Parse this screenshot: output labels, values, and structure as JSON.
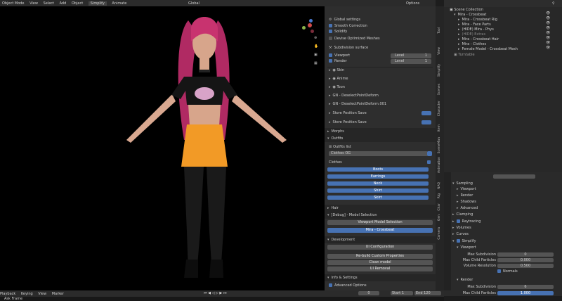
{
  "header": {
    "mode": "Object Mode",
    "menus": [
      "View",
      "Select",
      "Add",
      "Object"
    ],
    "addon": "Simplify",
    "addon2": "Animate",
    "transform": "Global",
    "options": "Options"
  },
  "npanel": {
    "global_settings": "Global settings",
    "smooth_correction": "Smooth Correction",
    "solidify": "Solidify",
    "devices_optimized": "Devise Optimized Meshes",
    "subdivision": "Subdivision surface",
    "viewport_label": "Viewport",
    "render_label": "Render",
    "level_label": "Level",
    "level_vp": "1",
    "level_r": "1",
    "items": [
      "Skin",
      "Anime",
      "Toon",
      "GN - DeselectPointDeform",
      "GN - DeselectPointDeform.001",
      "Store Position Save",
      "Store Position Save"
    ],
    "morphs": "Morphs",
    "outfits": "Outfits",
    "outfits_list": "Outfits list",
    "outfit_selected": "Clothes OG",
    "clothes": "Clothes",
    "clothes_items": [
      "Boots",
      "Earrings",
      "Neck",
      "Shirt",
      "Skirt"
    ],
    "hair": "Hair",
    "model_selection_header": "[Debug] - Model Selection",
    "viewport_model_selection": "Viewport Model Selection",
    "model_name": "Mira - Crossbeat",
    "development": "Development",
    "ui_configuration": "UI Configuration",
    "rebuild": "Re-build Custom Properties",
    "clean_model": "Clean model",
    "ui_removal": "UI Removal",
    "info_settings": "Info & Settings",
    "advanced_options": "Advanced Options",
    "tabs": [
      "Tool",
      "View",
      "Simplify",
      "Scenes",
      "Character",
      "Item",
      "SceneMan",
      "Animation",
      "NAQ",
      "Rig",
      "Char",
      "Gen",
      "Camera"
    ]
  },
  "outliner": {
    "scene_collection": "Scene Collection",
    "items": [
      "Mira - Crossbeat",
      "Mira - Crossbeat Rig",
      "Mira - Face Parts",
      "(HIDE) Mira - Phys",
      "(HIDE) Extras",
      "Mira - Crossbeat Hair",
      "Mira - Clothes",
      "Female Model - Crossbeat Mesh"
    ],
    "turntable": "Turntable"
  },
  "properties": {
    "sampling": "Sampling",
    "viewport": "Viewport",
    "render": "Render",
    "shadows": "Shadows",
    "advanced": "Advanced",
    "clamping": "Clamping",
    "raytracing": "Raytracing",
    "volumes": "Volumes",
    "curves": "Curves",
    "simplify": "Simplify",
    "viewport_sub": "Viewport",
    "max_subdivision": "Max Subdivision",
    "max_child_particles": "Max Child Particles",
    "volume_resolution": "Volume Resolution",
    "normals": "Normals",
    "render_sub": "Render",
    "vp_max_subdiv_val": "0",
    "vp_child_val": "0.000",
    "vp_vol_val": "0.500",
    "r_max_subdiv_val": "6",
    "r_child_val": "1.000"
  },
  "timeline": {
    "playback": "Playback",
    "keying": "Keying",
    "view": "View",
    "marker": "Marker",
    "current": "0",
    "start_label": "Start",
    "start": "1",
    "end_label": "End",
    "end": "120"
  },
  "status": {
    "text": "Ask Frame"
  }
}
